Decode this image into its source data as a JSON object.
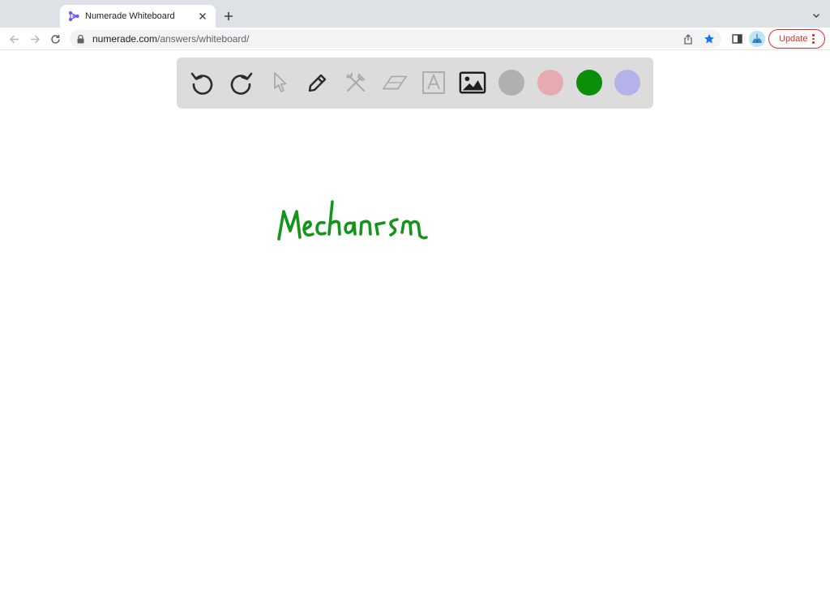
{
  "browser": {
    "tab_title": "Numerade Whiteboard",
    "url_host": "numerade.com",
    "url_path": "/answers/whiteboard/",
    "update_label": "Update"
  },
  "whiteboard": {
    "tools": [
      {
        "name": "undo-icon",
        "enabled": true
      },
      {
        "name": "redo-icon",
        "enabled": true
      },
      {
        "name": "pointer-icon",
        "enabled": false
      },
      {
        "name": "pen-icon",
        "enabled": true
      },
      {
        "name": "tools-icon",
        "enabled": false
      },
      {
        "name": "eraser-icon",
        "enabled": false
      },
      {
        "name": "text-icon",
        "enabled": false
      },
      {
        "name": "image-icon",
        "enabled": true
      }
    ],
    "colors": [
      "#b0b0b0",
      "#e6aab1",
      "#0b8f0b",
      "#b4b2e8"
    ],
    "handwritten_text": "Mechanism",
    "ink_color": "#14941a"
  }
}
